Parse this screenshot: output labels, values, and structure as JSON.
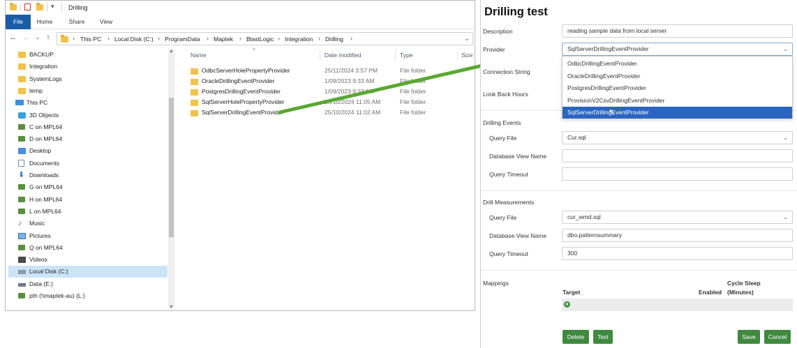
{
  "explorer": {
    "title": "Drilling",
    "ribbon_tabs": {
      "file": "File",
      "home": "Home",
      "share": "Share",
      "view": "View"
    },
    "breadcrumbs": [
      "This PC",
      "Local Disk (C:)",
      "ProgramData",
      "Maptek",
      "BlastLogic",
      "Integration",
      "Drilling"
    ],
    "nav_items": [
      {
        "label": "BACKUP",
        "icon": "folder-icon"
      },
      {
        "label": "Integration",
        "icon": "folder-icon"
      },
      {
        "label": "SystemLogs",
        "icon": "folder-icon"
      },
      {
        "label": "temp",
        "icon": "folder-icon"
      },
      {
        "label": "This PC",
        "icon": "pc-icon"
      },
      {
        "label": "3D Objects",
        "icon": "cube-icon"
      },
      {
        "label": "C on MPL64",
        "icon": "network-drive-icon"
      },
      {
        "label": "D on MPL64",
        "icon": "network-drive-icon"
      },
      {
        "label": "Desktop",
        "icon": "desktop-icon"
      },
      {
        "label": "Documents",
        "icon": "documents-icon"
      },
      {
        "label": "Downloads",
        "icon": "downloads-icon"
      },
      {
        "label": "G on MPL64",
        "icon": "network-drive-icon"
      },
      {
        "label": "H on MPL64",
        "icon": "network-drive-icon"
      },
      {
        "label": "L on MPL64",
        "icon": "network-drive-icon"
      },
      {
        "label": "Music",
        "icon": "music-icon"
      },
      {
        "label": "Pictures",
        "icon": "pictures-icon"
      },
      {
        "label": "Q on MPL64",
        "icon": "network-drive-icon"
      },
      {
        "label": "Videos",
        "icon": "videos-icon"
      },
      {
        "label": "Local Disk (C:)",
        "icon": "disk-icon"
      },
      {
        "label": "Data (E:)",
        "icon": "disk-icon"
      },
      {
        "label": "pth (\\\\maptek-au) (L:)",
        "icon": "network-drive-icon"
      }
    ],
    "columns": {
      "name": "Name",
      "date": "Date modified",
      "type": "Type",
      "size": "Size"
    },
    "files": [
      {
        "name": "OdbcServerHolePropertyProvider",
        "date": "25/11/2024 3:57 PM",
        "type": "File folder"
      },
      {
        "name": "OracleDrillingEventProvider",
        "date": "1/09/2023 9:33 AM",
        "type": "File folder"
      },
      {
        "name": "PostgresDrillingEventProvider",
        "date": "1/09/2023 9:33 AM",
        "type": "File folder"
      },
      {
        "name": "SqlServerHolePropertyProvider",
        "date": "25/10/2024 11:05 AM",
        "type": "File folder"
      },
      {
        "name": "SqlServerDrillingEventProvider",
        "date": "25/10/2024 11:02 AM",
        "type": "File folder"
      }
    ]
  },
  "form": {
    "title": "Drilling test",
    "description_label": "Description",
    "description_value": "reading sample data from local server",
    "provider_label": "Provider",
    "provider_value": "SqlServerDrillingEventProvider",
    "provider_options": [
      "OdbcDrillingEventProvider",
      "OracleDrillingEventProvider",
      "PostgresDrillingEventProvider",
      "ProvisionV2CsvDrillingEventProvider",
      "SqlServerDrillingEventProvider"
    ],
    "connection_string_label": "Connection String",
    "look_back_label": "Look Back Hours",
    "drilling_events": {
      "section": "Drilling Events",
      "query_file_label": "Query File",
      "query_file_value": "Cur.sql",
      "view_name_label": "Database View Name",
      "view_name_value": "",
      "timeout_label": "Query Timeout",
      "timeout_value": ""
    },
    "drill_measurements": {
      "section": "Drill Measurements",
      "query_file_label": "Query File",
      "query_file_value": "cur_wmd.sql",
      "view_name_label": "Database View Name",
      "view_name_value": "dbo.patternsummary",
      "timeout_label": "Query Timeout",
      "timeout_value": "300"
    },
    "mappings": {
      "section": "Mappings",
      "col_target": "Target",
      "col_enabled": "Enabled",
      "col_cycle_1": "Cycle Sleep",
      "col_cycle_2": "(Minutes)"
    },
    "buttons": {
      "delete": "Delete",
      "test": "Test",
      "save": "Save",
      "cancel": "Cancel"
    }
  },
  "colors": {
    "arrow": "#5aa832",
    "button": "#3f8a3f",
    "selection": "#2b65c2",
    "file_tab": "#1a5ca8"
  }
}
